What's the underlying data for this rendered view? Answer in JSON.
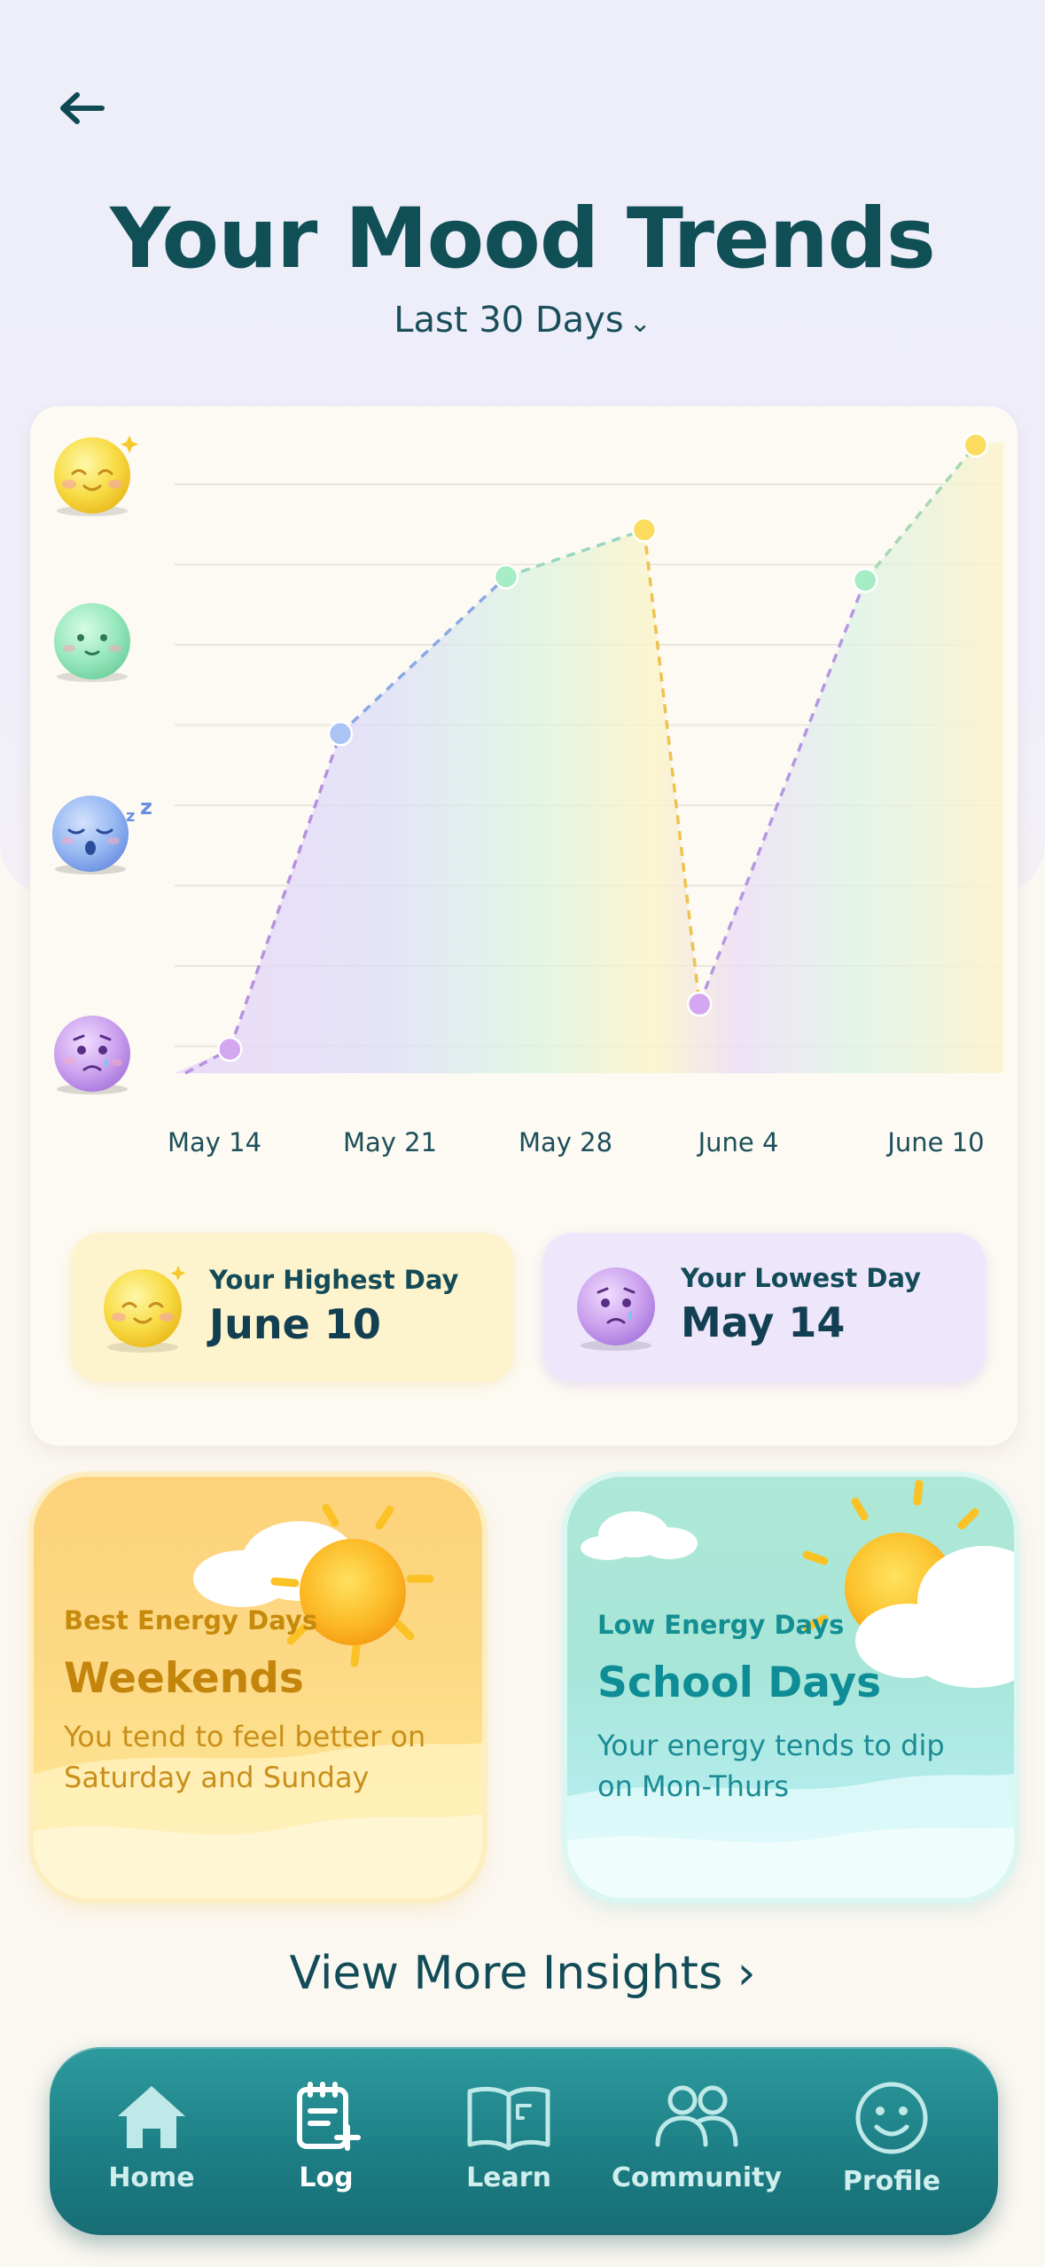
{
  "header": {
    "title": "Your Mood Trends",
    "range_label": "Last 30 Days",
    "range_chevron": "⌄"
  },
  "chart_data": {
    "type": "line",
    "x": [
      "May 14",
      "May 18",
      "May 24",
      "May 29",
      "May 31",
      "June 6",
      "June 10"
    ],
    "xticks": [
      "May 14",
      "May 21",
      "May 28",
      "June 4",
      "June 10"
    ],
    "y_levels": [
      "sad",
      "tired",
      "calm",
      "happy"
    ],
    "y_scale": [
      1,
      4
    ],
    "series": [
      {
        "values": [
          1.0,
          2.75,
          3.62,
          3.88,
          1.25,
          3.6,
          4.35
        ]
      }
    ],
    "point_colors": [
      "#d4a8f0",
      "#a9c4f5",
      "#a6ecc4",
      "#fbdc5f",
      "#d4a8f0",
      "#a6ecc4",
      "#fbdc5f"
    ],
    "xlabel": "",
    "ylabel": "",
    "grid": true
  },
  "stats": {
    "highest_label": "Your Highest Day",
    "highest_value": "June 10",
    "lowest_label": "Your Lowest Day",
    "lowest_value": "May 14"
  },
  "cards": {
    "best": {
      "kicker": "Best Energy Days",
      "heading": "Weekends",
      "description": "You tend to feel better on Saturday and Sunday"
    },
    "low": {
      "kicker": "Low Energy Days",
      "heading": "School Days",
      "description": "Your energy tends to dip on Mon-Thurs"
    }
  },
  "more_link": "View More Insights ›",
  "nav": {
    "items": [
      {
        "label": "Home",
        "icon": "home-icon"
      },
      {
        "label": "Log",
        "icon": "log-icon",
        "active": true
      },
      {
        "label": "Learn",
        "icon": "book-icon"
      },
      {
        "label": "Community",
        "icon": "community-icon"
      },
      {
        "label": "Profile",
        "icon": "smiley-icon"
      }
    ]
  },
  "colors": {
    "accent": "#1d7f85",
    "title": "#104f56",
    "happy": "#fbdc5f",
    "calm": "#a6ecc4",
    "tired": "#a9c4f5",
    "sad": "#d4a8f0"
  }
}
